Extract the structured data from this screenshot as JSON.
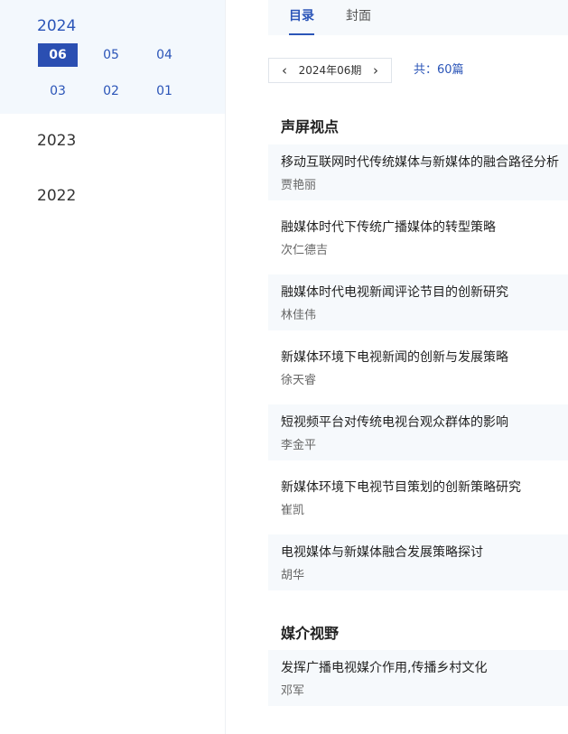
{
  "sidebar": {
    "active_year": "2024",
    "months": [
      "06",
      "05",
      "04",
      "03",
      "02",
      "01"
    ],
    "selected_month": "06",
    "other_years": [
      "2023",
      "2022"
    ]
  },
  "tabs": [
    {
      "label": "目录",
      "active": true
    },
    {
      "label": "封面",
      "active": false
    }
  ],
  "issue": {
    "label": "2024年06期",
    "count": "共：60篇"
  },
  "sections": [
    {
      "title": "声屏视点",
      "articles": [
        {
          "title": "移动互联网时代传统媒体与新媒体的融合路径分析",
          "author": "贾艳丽"
        },
        {
          "title": "融媒体时代下传统广播媒体的转型策略",
          "author": "次仁德吉"
        },
        {
          "title": "融媒体时代电视新闻评论节目的创新研究",
          "author": "林佳伟"
        },
        {
          "title": "新媒体环境下电视新闻的创新与发展策略",
          "author": "徐天睿"
        },
        {
          "title": "短视频平台对传统电视台观众群体的影响",
          "author": "李金平"
        },
        {
          "title": "新媒体环境下电视节目策划的创新策略研究",
          "author": "崔凯"
        },
        {
          "title": "电视媒体与新媒体融合发展策略探讨",
          "author": "胡华"
        }
      ]
    },
    {
      "title": "媒介视野",
      "articles": [
        {
          "title": "发挥广播电视媒介作用,传播乡村文化",
          "author": "邓军"
        }
      ]
    }
  ],
  "colors": {
    "accent": "#2b55b8",
    "selected_bg": "#2b4fb2",
    "shade": "#f6f9fc"
  }
}
